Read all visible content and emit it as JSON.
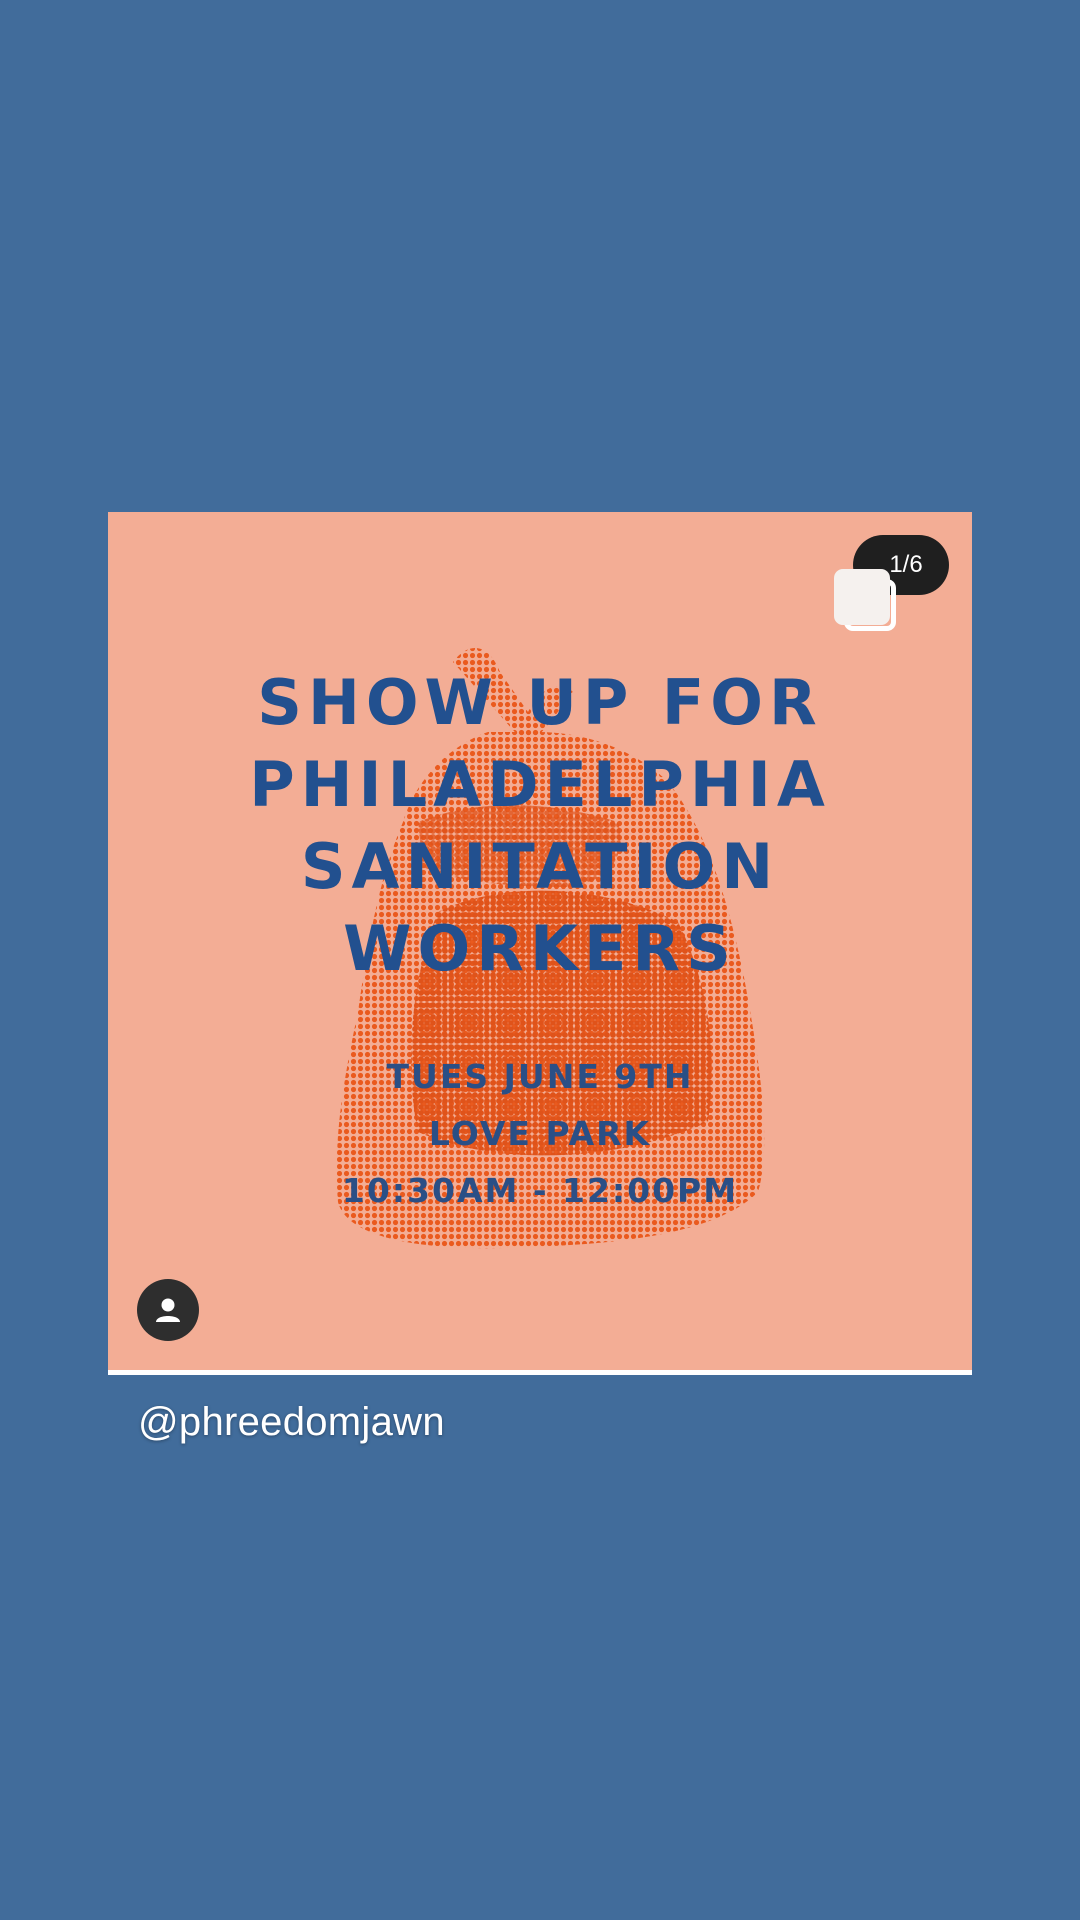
{
  "post": {
    "headline_lines": [
      "SHOW UP FOR",
      "PHILADELPHIA",
      "SANITATION",
      "WORKERS"
    ],
    "details": {
      "date": "TUES JUNE 9TH",
      "location": "LOVE PARK",
      "time": "10:30AM - 12:00PM"
    },
    "slide_counter": "1/6",
    "icons": {
      "multi": "multiple-images-icon",
      "avatar": "user-avatar-icon",
      "graphic": "trash-bag-graphic"
    }
  },
  "mention": "@phreedomjawn",
  "colors": {
    "background": "#416c9b",
    "card": "#f3ad95",
    "headline": "#22508f",
    "bag": "#ea5a1e"
  }
}
